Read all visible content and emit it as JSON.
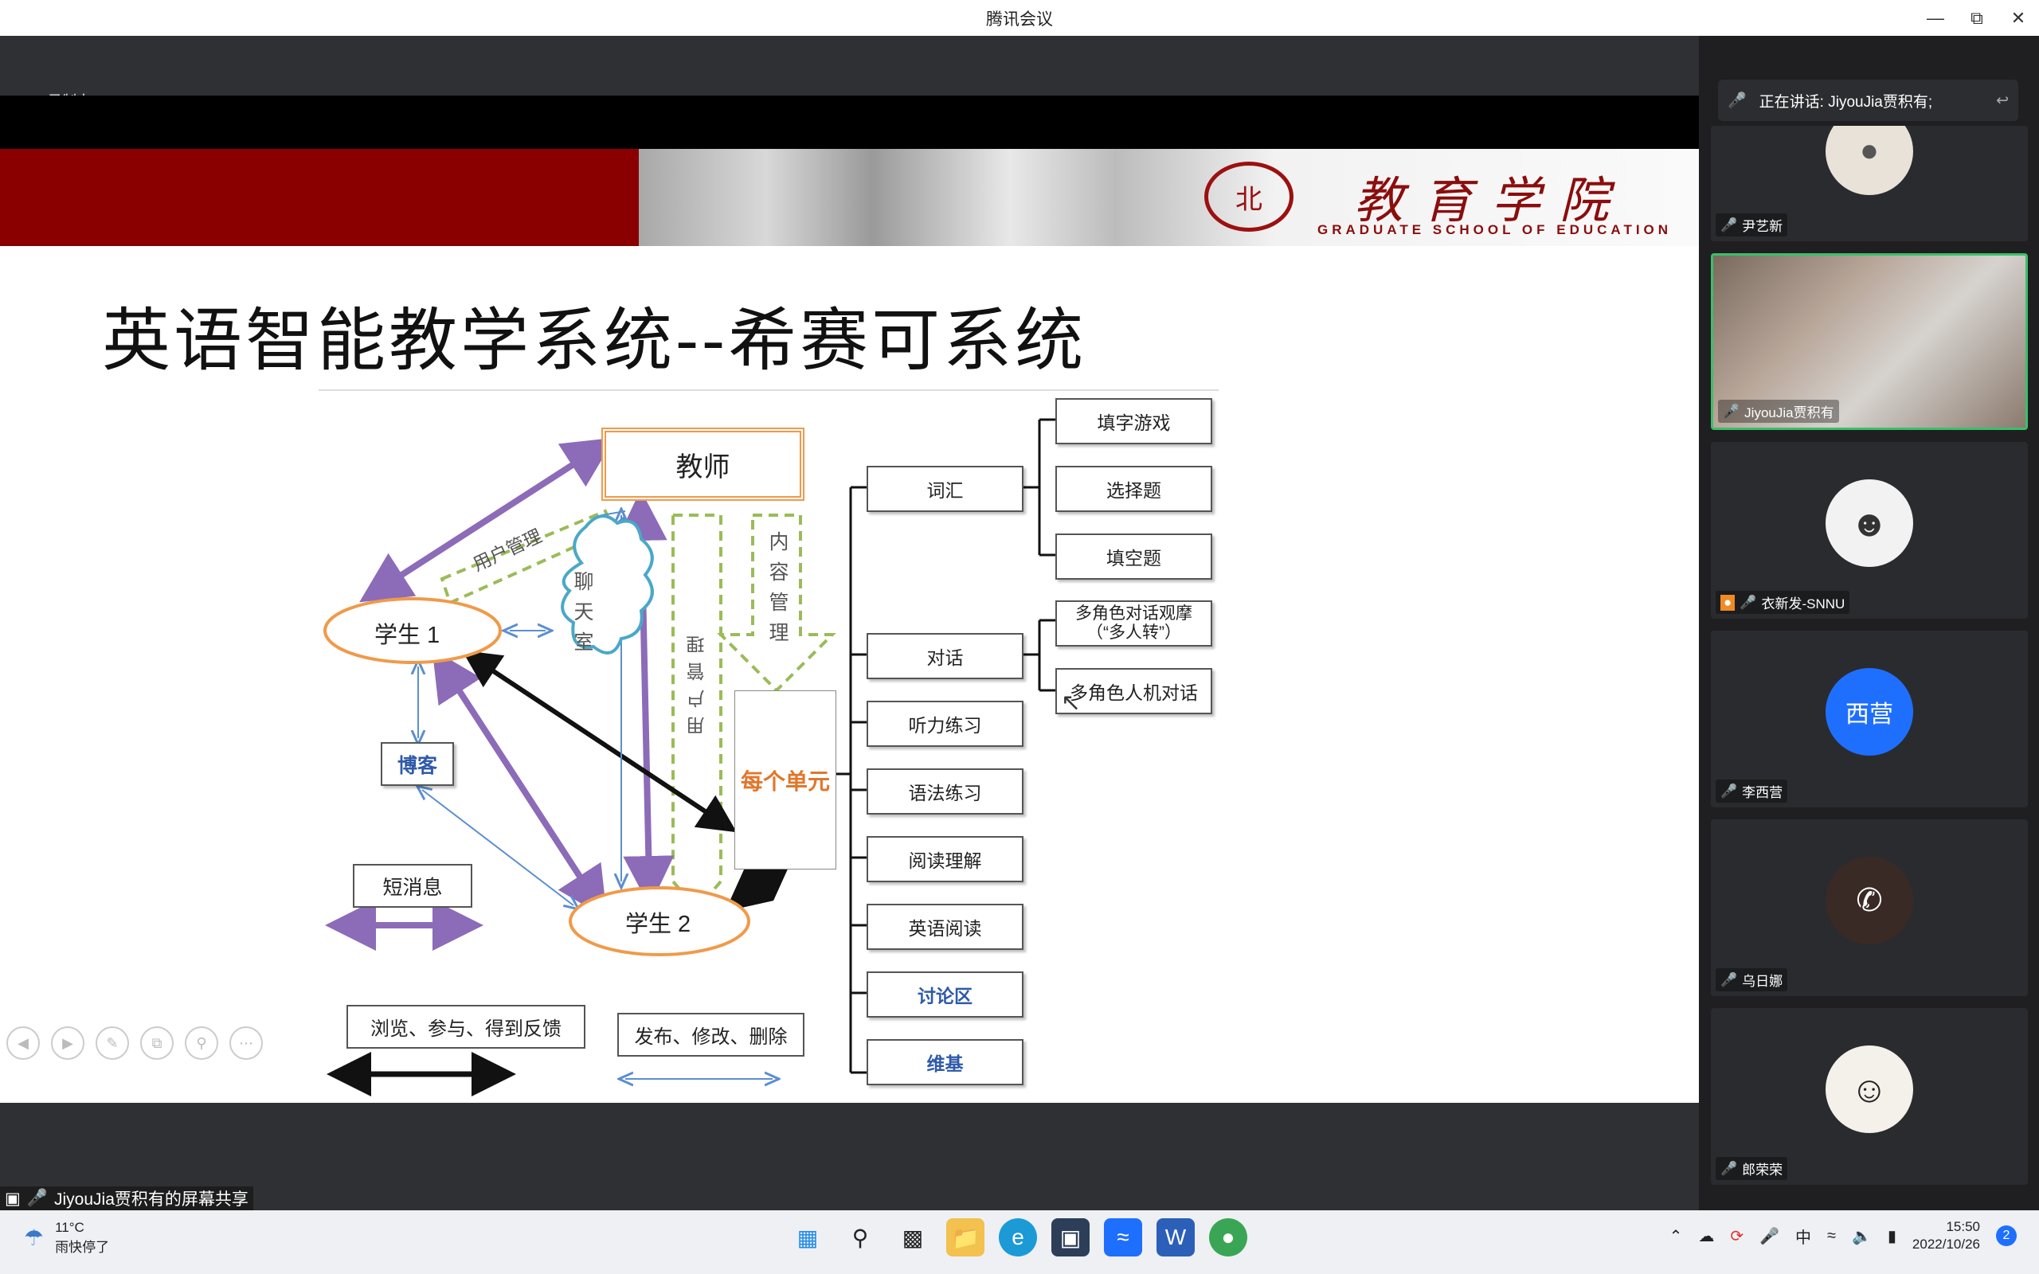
{
  "window": {
    "title": "腾讯会议",
    "controls": [
      "minimize",
      "restore",
      "close"
    ]
  },
  "recording": {
    "label": "录制中"
  },
  "slide": {
    "banner": {
      "school_cn": "教育学院",
      "school_en": "GRADUATE SCHOOL OF EDUCATION",
      "seal_glyph": "北"
    },
    "title": "英语智能教学系统--希赛可系统",
    "diagram": {
      "teacher": "教师",
      "student1": "学生 1",
      "student2": "学生 2",
      "user_mgmt": "用户管理",
      "chatroom": "聊天室",
      "blog": "博客",
      "sms": "短消息",
      "content_mgmt": "内容管理",
      "user_mgmt_v": "用户管理",
      "each_unit": "每个单元",
      "legend_black": "浏览、参与、得到反馈",
      "legend_blue": "发布、修改、删除",
      "modules": [
        "词汇",
        "对话",
        "听力练习",
        "语法练习",
        "阅读理解",
        "英语阅读",
        "讨论区",
        "维基"
      ],
      "vocab_sub": [
        "填字游戏",
        "选择题",
        "填空题"
      ],
      "dialog_sub": [
        "多角色对话观摩（“多人转”）",
        "多角色人机对话"
      ]
    },
    "tools": [
      "prev",
      "next",
      "pen",
      "copy",
      "zoom",
      "more"
    ]
  },
  "share_bar": {
    "label": "JiyouJia贾积有的屏幕共享"
  },
  "sidebar": {
    "speaking": "正在讲话: JiyouJia贾积有;",
    "participants": [
      {
        "name": "尹艺新",
        "avatar": "dog-photo"
      },
      {
        "name": "JiyouJia贾积有",
        "avatar": "video"
      },
      {
        "name": "衣新发-SNNU",
        "avatar": "cartoon-man"
      },
      {
        "name": "李西营",
        "avatar_text": "西营"
      },
      {
        "name": "乌日娜",
        "avatar": "phone"
      },
      {
        "name": "郎荣荣",
        "avatar": "cartoon-woman"
      }
    ]
  },
  "taskbar": {
    "weather": {
      "temp": "11°C",
      "desc": "雨快停了"
    },
    "ime": "中",
    "time": "15:50",
    "date": "2022/10/26",
    "notifications": "2"
  }
}
